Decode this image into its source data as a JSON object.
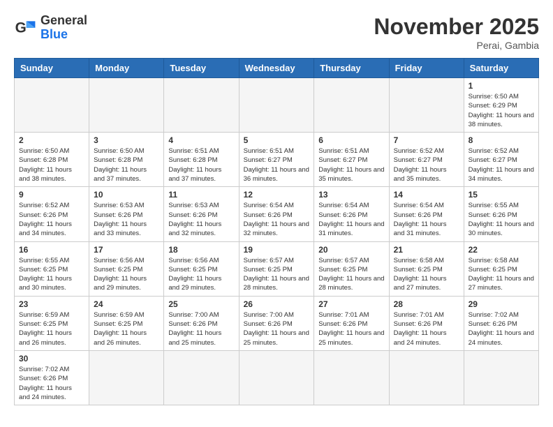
{
  "logo": {
    "text_general": "General",
    "text_blue": "Blue"
  },
  "title": "November 2025",
  "location": "Perai, Gambia",
  "days_of_week": [
    "Sunday",
    "Monday",
    "Tuesday",
    "Wednesday",
    "Thursday",
    "Friday",
    "Saturday"
  ],
  "weeks": [
    [
      {
        "day": "",
        "empty": true
      },
      {
        "day": "",
        "empty": true
      },
      {
        "day": "",
        "empty": true
      },
      {
        "day": "",
        "empty": true
      },
      {
        "day": "",
        "empty": true
      },
      {
        "day": "",
        "empty": true
      },
      {
        "day": "1",
        "sunrise": "6:50 AM",
        "sunset": "6:29 PM",
        "daylight": "11 hours and 38 minutes."
      }
    ],
    [
      {
        "day": "2",
        "sunrise": "6:50 AM",
        "sunset": "6:28 PM",
        "daylight": "11 hours and 38 minutes."
      },
      {
        "day": "3",
        "sunrise": "6:50 AM",
        "sunset": "6:28 PM",
        "daylight": "11 hours and 37 minutes."
      },
      {
        "day": "4",
        "sunrise": "6:51 AM",
        "sunset": "6:28 PM",
        "daylight": "11 hours and 37 minutes."
      },
      {
        "day": "5",
        "sunrise": "6:51 AM",
        "sunset": "6:27 PM",
        "daylight": "11 hours and 36 minutes."
      },
      {
        "day": "6",
        "sunrise": "6:51 AM",
        "sunset": "6:27 PM",
        "daylight": "11 hours and 35 minutes."
      },
      {
        "day": "7",
        "sunrise": "6:52 AM",
        "sunset": "6:27 PM",
        "daylight": "11 hours and 35 minutes."
      },
      {
        "day": "8",
        "sunrise": "6:52 AM",
        "sunset": "6:27 PM",
        "daylight": "11 hours and 34 minutes."
      }
    ],
    [
      {
        "day": "9",
        "sunrise": "6:52 AM",
        "sunset": "6:26 PM",
        "daylight": "11 hours and 34 minutes."
      },
      {
        "day": "10",
        "sunrise": "6:53 AM",
        "sunset": "6:26 PM",
        "daylight": "11 hours and 33 minutes."
      },
      {
        "day": "11",
        "sunrise": "6:53 AM",
        "sunset": "6:26 PM",
        "daylight": "11 hours and 32 minutes."
      },
      {
        "day": "12",
        "sunrise": "6:54 AM",
        "sunset": "6:26 PM",
        "daylight": "11 hours and 32 minutes."
      },
      {
        "day": "13",
        "sunrise": "6:54 AM",
        "sunset": "6:26 PM",
        "daylight": "11 hours and 31 minutes."
      },
      {
        "day": "14",
        "sunrise": "6:54 AM",
        "sunset": "6:26 PM",
        "daylight": "11 hours and 31 minutes."
      },
      {
        "day": "15",
        "sunrise": "6:55 AM",
        "sunset": "6:26 PM",
        "daylight": "11 hours and 30 minutes."
      }
    ],
    [
      {
        "day": "16",
        "sunrise": "6:55 AM",
        "sunset": "6:25 PM",
        "daylight": "11 hours and 30 minutes."
      },
      {
        "day": "17",
        "sunrise": "6:56 AM",
        "sunset": "6:25 PM",
        "daylight": "11 hours and 29 minutes."
      },
      {
        "day": "18",
        "sunrise": "6:56 AM",
        "sunset": "6:25 PM",
        "daylight": "11 hours and 29 minutes."
      },
      {
        "day": "19",
        "sunrise": "6:57 AM",
        "sunset": "6:25 PM",
        "daylight": "11 hours and 28 minutes."
      },
      {
        "day": "20",
        "sunrise": "6:57 AM",
        "sunset": "6:25 PM",
        "daylight": "11 hours and 28 minutes."
      },
      {
        "day": "21",
        "sunrise": "6:58 AM",
        "sunset": "6:25 PM",
        "daylight": "11 hours and 27 minutes."
      },
      {
        "day": "22",
        "sunrise": "6:58 AM",
        "sunset": "6:25 PM",
        "daylight": "11 hours and 27 minutes."
      }
    ],
    [
      {
        "day": "23",
        "sunrise": "6:59 AM",
        "sunset": "6:25 PM",
        "daylight": "11 hours and 26 minutes."
      },
      {
        "day": "24",
        "sunrise": "6:59 AM",
        "sunset": "6:25 PM",
        "daylight": "11 hours and 26 minutes."
      },
      {
        "day": "25",
        "sunrise": "7:00 AM",
        "sunset": "6:26 PM",
        "daylight": "11 hours and 25 minutes."
      },
      {
        "day": "26",
        "sunrise": "7:00 AM",
        "sunset": "6:26 PM",
        "daylight": "11 hours and 25 minutes."
      },
      {
        "day": "27",
        "sunrise": "7:01 AM",
        "sunset": "6:26 PM",
        "daylight": "11 hours and 25 minutes."
      },
      {
        "day": "28",
        "sunrise": "7:01 AM",
        "sunset": "6:26 PM",
        "daylight": "11 hours and 24 minutes."
      },
      {
        "day": "29",
        "sunrise": "7:02 AM",
        "sunset": "6:26 PM",
        "daylight": "11 hours and 24 minutes."
      }
    ],
    [
      {
        "day": "30",
        "sunrise": "7:02 AM",
        "sunset": "6:26 PM",
        "daylight": "11 hours and 24 minutes."
      },
      {
        "day": "",
        "empty": true
      },
      {
        "day": "",
        "empty": true
      },
      {
        "day": "",
        "empty": true
      },
      {
        "day": "",
        "empty": true
      },
      {
        "day": "",
        "empty": true
      },
      {
        "day": "",
        "empty": true
      }
    ]
  ]
}
